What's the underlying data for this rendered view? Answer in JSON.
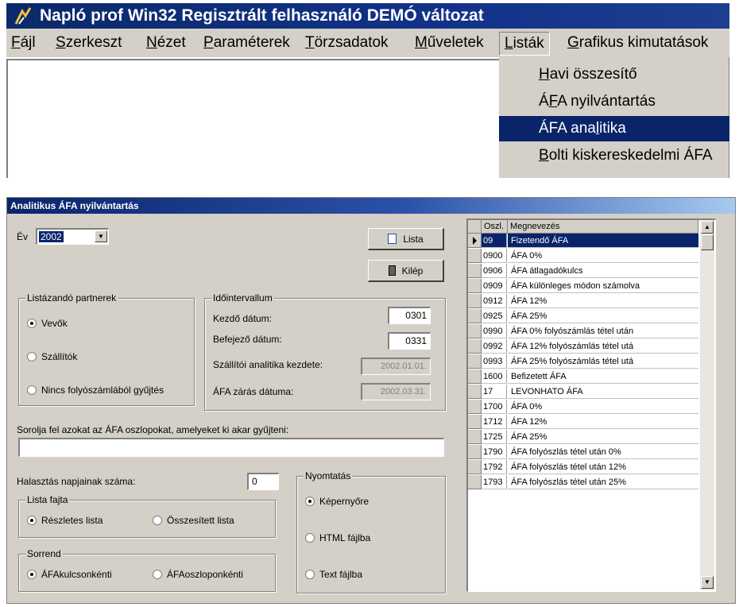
{
  "app": {
    "title": "Napló prof Win32 Regisztrált felhasználó  DEMÓ változat",
    "menu": [
      {
        "label": "Fájl",
        "u": "F",
        "rest": "ájl"
      },
      {
        "label": "Szerkeszt",
        "u": "S",
        "rest": "zerkeszt"
      },
      {
        "label": "Nézet",
        "u": "N",
        "rest": "ézet"
      },
      {
        "label": "Paraméterek",
        "u": "P",
        "rest": "araméterek"
      },
      {
        "label": "Törzsadatok",
        "u": "T",
        "rest": "örzsadatok"
      },
      {
        "label": "Műveletek",
        "u": "M",
        "rest": "űveletek"
      },
      {
        "label": "Listák",
        "u": "L",
        "rest": "isták"
      },
      {
        "label": "Grafikus kimutatások",
        "u": "G",
        "rest": "rafikus kimutatások"
      }
    ],
    "dropdown": [
      {
        "pre": "",
        "u": "H",
        "post": "avi összesítő"
      },
      {
        "pre": "Á",
        "u": "F",
        "post": "A nyilvántartás"
      },
      {
        "pre": "ÁFA ana",
        "u": "l",
        "post": "itika"
      },
      {
        "pre": "",
        "u": "B",
        "post": "olti kiskereskedelmi ÁFA"
      }
    ],
    "dropdown_selected_index": 2
  },
  "dialog": {
    "title": "Analitikus ÁFA nyilvántartás",
    "year_label": "Év",
    "year_value": "2002",
    "lista_button": "Lista",
    "kilep_button": "Kilép",
    "partners": {
      "caption": "Listázandó partnerek",
      "options": [
        "Vevők",
        "Szállítók",
        "Nincs folyószámlából gyűjtés"
      ],
      "selected": 0
    },
    "interval": {
      "caption": "Időintervallum",
      "start_label": "Kezdő dátum:",
      "start_value": "0301",
      "end_label": "Befejező dátum:",
      "end_value": "0331",
      "supplier_label": "Szállítói analitika kezdete:",
      "supplier_value": "2002.01.01.",
      "close_label": "ÁFA zárás dátuma:",
      "close_value": "2002.03.31."
    },
    "columns_prompt": "Sorolja fel azokat az ÁFA oszlopokat, amelyeket ki akar gyűjteni:",
    "columns_value": "",
    "delay_label": "Halasztás napjainak száma:",
    "delay_value": "0",
    "list_type": {
      "caption": "Lista fajta",
      "options": [
        "Részletes lista",
        "Összesített lista"
      ],
      "selected": 0
    },
    "order": {
      "caption": "Sorrend",
      "options": [
        "ÁFAkulcsonkénti",
        "ÁFAoszloponkénti"
      ],
      "selected": 0
    },
    "print": {
      "caption": "Nyomtatás",
      "options": [
        "Képernyőre",
        "HTML fájlba",
        "Text fájlba"
      ],
      "selected": 0
    },
    "grid": {
      "headers": [
        "Oszl.",
        "Megnevezés"
      ],
      "selected_row": 0,
      "rows": [
        [
          "09",
          "Fizetendő ÁFA"
        ],
        [
          "0900",
          "ÁFA  0%"
        ],
        [
          "0906",
          "ÁFA átlagadókulcs"
        ],
        [
          "0909",
          "ÁFA különleges módon számolva"
        ],
        [
          "0912",
          "ÁFA 12%"
        ],
        [
          "0925",
          "ÁFA 25%"
        ],
        [
          "0990",
          "ÁFA 0% folyószámlás tétel után"
        ],
        [
          "0992",
          "ÁFA 12% folyószámlás tétel utá"
        ],
        [
          "0993",
          "ÁFA 25% folyószámlás tétel utá"
        ],
        [
          "1600",
          "Befizetett ÁFA"
        ],
        [
          "17",
          "LEVONHATO ÁFA"
        ],
        [
          "1700",
          "ÁFA  0%"
        ],
        [
          "1712",
          "ÁFA 12%"
        ],
        [
          "1725",
          "ÁFA 25%"
        ],
        [
          "1790",
          "ÁFA folyószlás tétel után 0%"
        ],
        [
          "1792",
          "ÁFA folyószlás tétel után 12%"
        ],
        [
          "1793",
          "ÁFA folyószlás tétel után 25%"
        ]
      ]
    }
  }
}
